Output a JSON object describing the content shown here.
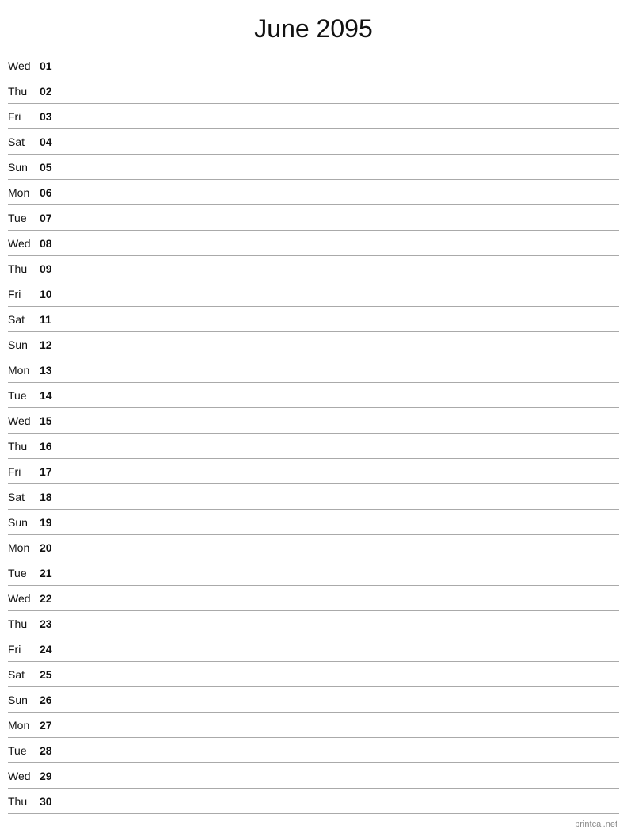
{
  "header": {
    "title": "June 2095"
  },
  "days": [
    {
      "name": "Wed",
      "num": "01"
    },
    {
      "name": "Thu",
      "num": "02"
    },
    {
      "name": "Fri",
      "num": "03"
    },
    {
      "name": "Sat",
      "num": "04"
    },
    {
      "name": "Sun",
      "num": "05"
    },
    {
      "name": "Mon",
      "num": "06"
    },
    {
      "name": "Tue",
      "num": "07"
    },
    {
      "name": "Wed",
      "num": "08"
    },
    {
      "name": "Thu",
      "num": "09"
    },
    {
      "name": "Fri",
      "num": "10"
    },
    {
      "name": "Sat",
      "num": "11"
    },
    {
      "name": "Sun",
      "num": "12"
    },
    {
      "name": "Mon",
      "num": "13"
    },
    {
      "name": "Tue",
      "num": "14"
    },
    {
      "name": "Wed",
      "num": "15"
    },
    {
      "name": "Thu",
      "num": "16"
    },
    {
      "name": "Fri",
      "num": "17"
    },
    {
      "name": "Sat",
      "num": "18"
    },
    {
      "name": "Sun",
      "num": "19"
    },
    {
      "name": "Mon",
      "num": "20"
    },
    {
      "name": "Tue",
      "num": "21"
    },
    {
      "name": "Wed",
      "num": "22"
    },
    {
      "name": "Thu",
      "num": "23"
    },
    {
      "name": "Fri",
      "num": "24"
    },
    {
      "name": "Sat",
      "num": "25"
    },
    {
      "name": "Sun",
      "num": "26"
    },
    {
      "name": "Mon",
      "num": "27"
    },
    {
      "name": "Tue",
      "num": "28"
    },
    {
      "name": "Wed",
      "num": "29"
    },
    {
      "name": "Thu",
      "num": "30"
    }
  ],
  "watermark": "printcal.net"
}
